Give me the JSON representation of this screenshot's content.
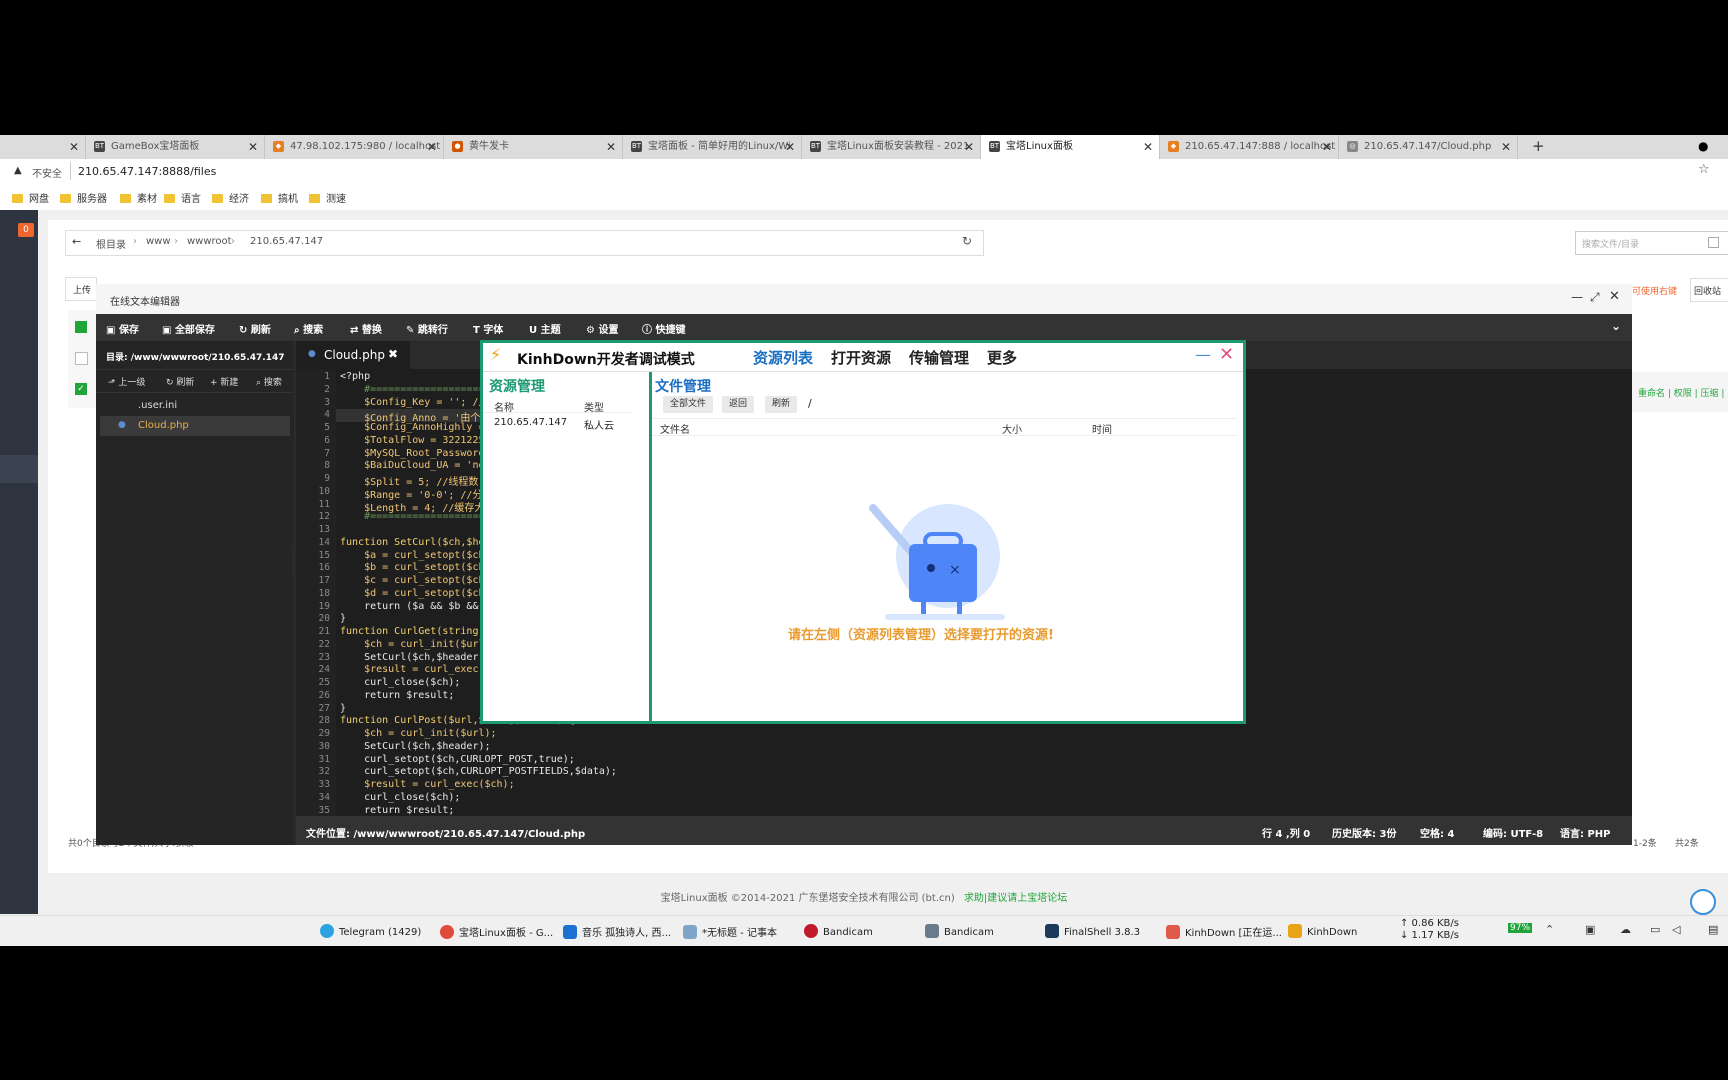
{
  "browser": {
    "tabs": [
      {
        "label": "GameBox宝塔面板",
        "icon": "BT"
      },
      {
        "label": "47.98.102.175:980 / localhost",
        "icon": "pma"
      },
      {
        "label": "黄牛发卡",
        "icon": "hn"
      },
      {
        "label": "宝塔面板 - 简单好用的Linux/Wi",
        "icon": "BT"
      },
      {
        "label": "宝塔Linux面板安装教程 - 2021",
        "icon": "BT"
      },
      {
        "label": "宝塔Linux面板",
        "icon": "BT"
      },
      {
        "label": "210.65.47.147:888 / localhost",
        "icon": "pma"
      },
      {
        "label": "210.65.47.147/Cloud.php",
        "icon": "globe"
      }
    ],
    "security_label": "不安全",
    "url": "210.65.47.147:8888/files",
    "bookmarks": [
      "网盘",
      "服务器",
      "素材",
      "语言",
      "经济",
      "搞机",
      "测速"
    ]
  },
  "filepage": {
    "badge": "0",
    "breadcrumb": [
      "根目录",
      "www",
      "wwwroot",
      "210.65.47.147"
    ],
    "search_placeholder": "搜索文件/目录",
    "upload_label": "上传",
    "right_hint": "可使用右键",
    "recycle_label": "回收站",
    "row_actions": "重命名 | 权限 | 压缩 |",
    "bottom_left": "共0个目录与2个文件,大小:获取",
    "pager": "1-2条",
    "total": "共2条",
    "copyright": "宝塔Linux面板 ©2014-2021 广东堡塔安全技术有限公司 (bt.cn)",
    "forum_link": "求助|建议请上宝塔论坛"
  },
  "editor": {
    "title": "在线文本编辑器",
    "toolbar": [
      "保存",
      "全部保存",
      "刷新",
      "搜索",
      "替换",
      "跳转行",
      "字体",
      "主题",
      "设置",
      "快捷键"
    ],
    "dir_label": "目录: /www/wwwroot/210.65.47.147",
    "tree_actions": [
      "上一级",
      "刷新",
      "新建",
      "搜索"
    ],
    "files": [
      ".user.ini",
      "Cloud.php"
    ],
    "open_tab": "Cloud.php",
    "status": {
      "path": "文件位置: /www/wwwroot/210.65.47.147/Cloud.php",
      "cursor": "行 4 ,列 0",
      "history": "历史版本: 3份",
      "indent": "空格: 4",
      "encoding": "编码: UTF-8",
      "language": "语言: PHP"
    },
    "code_lines": [
      "<?php",
      "    #====================",
      "    $Config_Key = ''; //",
      "    $Config_Anno = '由个",
      "    $Config_AnnoHighly =",
      "    $TotalFlow = 3221225",
      "    $MySQL_Root_Password",
      "    $BaiDuCloud_UA = 'ne",
      "    $Split = 5; //线程数",
      "    $Range = '0-0'; //分",
      "    $Length = 4; //缓存大",
      "    #====================",
      "",
      "function SetCurl($ch,$he",
      "    $a = curl_setopt($ch",
      "    $b = curl_setopt($ch",
      "    $c = curl_setopt($ch",
      "    $d = curl_setopt($ch",
      "    return ($a && $b &&",
      "}",
      "function CurlGet(string",
      "    $ch = curl_init($url",
      "    SetCurl($ch,$header)",
      "    $result = curl_exec(",
      "    curl_close($ch);",
      "    return $result;",
      "}",
      "function CurlPost($url,$data,$header) {",
      "    $ch = curl_init($url);",
      "    SetCurl($ch,$header);",
      "    curl_setopt($ch,CURLOPT_POST,true);",
      "    curl_setopt($ch,CURLOPT_POSTFIELDS,$data);",
      "    $result = curl_exec($ch);",
      "    curl_close($ch);",
      "    return $result;"
    ]
  },
  "kinhdown": {
    "title": "KinhDown开发者调试模式",
    "menu": [
      "资源列表",
      "打开资源",
      "传输管理",
      "更多"
    ],
    "left_heading": "资源管理",
    "left_cols": [
      "名称",
      "类型"
    ],
    "left_rows": [
      {
        "name": "210.65.47.147",
        "type": "私人云"
      }
    ],
    "right_heading": "文件管理",
    "buttons": [
      "全部文件",
      "返回",
      "刷新"
    ],
    "path": "/",
    "cols": [
      "文件名",
      "大小",
      "时间"
    ],
    "empty_message": "请在左侧（资源列表管理）选择要打开的资源!",
    "accent": "#1d9a73"
  },
  "taskbar": {
    "items": [
      "Telegram (1429)",
      "宝塔Linux面板 - G...",
      "音乐 孤独诗人, 西...",
      "*无标题 - 记事本",
      "Bandicam",
      "Bandicam",
      "FinalShell 3.8.3",
      "KinhDown [正在运...",
      "KinhDown"
    ],
    "net_up": "↑ 0.86 KB/s",
    "net_down": "↓ 1.17 KB/s",
    "battery": "97%"
  }
}
